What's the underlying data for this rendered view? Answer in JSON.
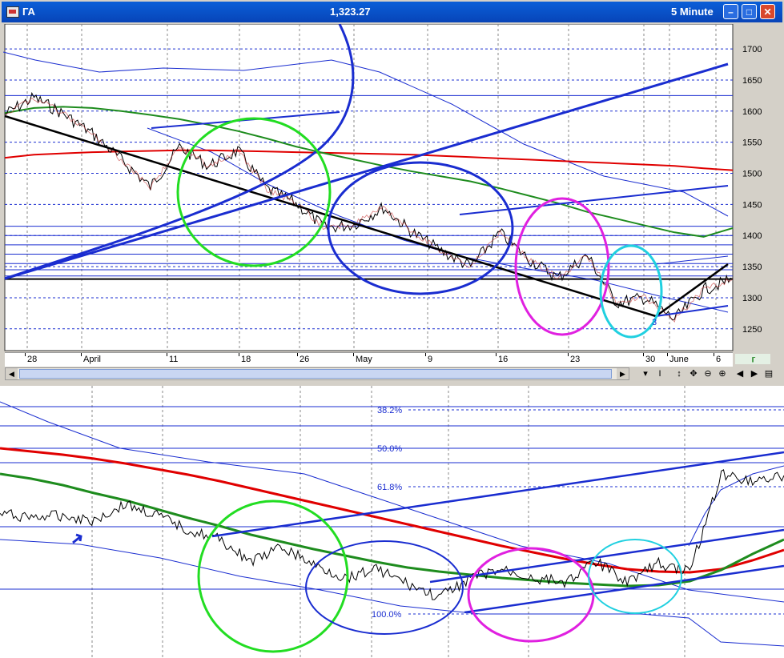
{
  "window": {
    "symbol": "ГА",
    "price": "1,323.27",
    "interval": "5 Minute",
    "minimize_icon": "minimize-icon",
    "maximize_icon": "maximize-icon",
    "close_icon": "close-icon"
  },
  "toolbar": {
    "cursor_label": "I",
    "icons": [
      "crosshair-icon",
      "move-icon",
      "zoom-out-icon",
      "zoom-in-icon",
      "scroll-left-icon",
      "scroll-right-icon",
      "window-icon"
    ]
  },
  "colors": {
    "price": "#000000",
    "ma_red": "#e00000",
    "ma_green": "#1e8c1e",
    "channel_blue": "#1a2dd0",
    "circle_green": "#22dd22",
    "circle_blue": "#1a2dd0",
    "circle_magenta": "#e020e0",
    "circle_cyan": "#20d0e0",
    "grid": "#1a2dd0"
  },
  "chart_data": [
    {
      "type": "line",
      "title": "",
      "x_tick_labels": [
        "28",
        "April",
        "11",
        "18",
        "26",
        "May",
        "9",
        "16",
        "23",
        "30",
        "June",
        "6"
      ],
      "y_tick_labels": [
        "1700",
        "1650",
        "1600",
        "1550",
        "1500",
        "1450",
        "1400",
        "1350",
        "1300",
        "1250"
      ],
      "ylim": [
        1215,
        1740
      ],
      "grid": true,
      "annotation": "3",
      "x": [
        0,
        4,
        8,
        12,
        16,
        20,
        24,
        28,
        32,
        36,
        40,
        44,
        48,
        52,
        56,
        60,
        64,
        68,
        72,
        76,
        80,
        84,
        88,
        92,
        96,
        100
      ],
      "series": [
        {
          "values": [
            1595,
            1622,
            1596,
            1564,
            1522,
            1478,
            1542,
            1512,
            1536,
            1475,
            1452,
            1412,
            1418,
            1445,
            1405,
            1375,
            1350,
            1404,
            1362,
            1332,
            1368,
            1292,
            1300,
            1265,
            1313,
            1330
          ]
        },
        {
          "values": [
            1525,
            1530,
            1532,
            1534,
            1535,
            1536,
            1537,
            1537,
            1536,
            1535,
            1534,
            1533,
            1532,
            1531,
            1530,
            1528,
            1526,
            1524,
            1522,
            1520,
            1518,
            1516,
            1514,
            1512,
            1508,
            1505
          ]
        },
        {
          "values": [
            1597,
            1605,
            1607,
            1605,
            1600,
            1594,
            1587,
            1578,
            1568,
            1556,
            1543,
            1532,
            1522,
            1512,
            1503,
            1495,
            1487,
            1476,
            1464,
            1452,
            1438,
            1427,
            1416,
            1405,
            1398,
            1412
          ]
        }
      ]
    },
    {
      "type": "line",
      "title": "",
      "annotations": [
        "38.2%",
        "50.0%",
        "61.8%",
        "100.0%"
      ],
      "ylim": [
        0,
        340
      ],
      "x": [
        0,
        4,
        8,
        12,
        16,
        20,
        24,
        28,
        32,
        36,
        40,
        44,
        48,
        52,
        56,
        60,
        64,
        68,
        72,
        76,
        80,
        84,
        88,
        92,
        96,
        100
      ],
      "series": [
        {
          "values": [
            180,
            176,
            178,
            172,
            192,
            178,
            160,
            148,
            120,
            138,
            116,
            100,
            112,
            92,
            75,
            100,
            110,
            100,
            95,
            120,
            96,
            118,
            108,
            230,
            222,
            228
          ]
        },
        {
          "values": [
            262,
            258,
            254,
            249,
            243,
            236,
            229,
            221,
            212,
            203,
            194,
            185,
            176,
            167,
            158,
            149,
            140,
            132,
            124,
            117,
            111,
            108,
            107,
            111,
            122,
            135
          ]
        },
        {
          "values": [
            230,
            224,
            216,
            206,
            197,
            186,
            175,
            165,
            154,
            145,
            136,
            128,
            120,
            113,
            108,
            104,
            100,
            97,
            94,
            92,
            90,
            91,
            96,
            110,
            130,
            148
          ]
        }
      ]
    }
  ]
}
